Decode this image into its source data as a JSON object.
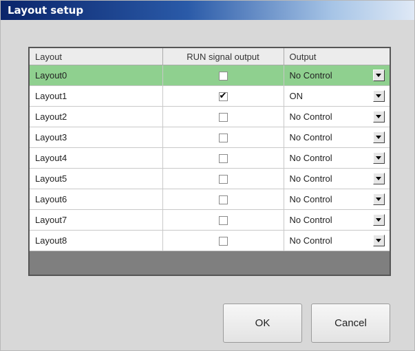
{
  "window": {
    "title": "Layout setup"
  },
  "table": {
    "columns": [
      "Layout",
      "RUN signal output",
      "Output"
    ],
    "rows": [
      {
        "layout": "Layout0",
        "run_signal": false,
        "output": "No Control",
        "selected": true
      },
      {
        "layout": "Layout1",
        "run_signal": true,
        "output": "ON",
        "selected": false
      },
      {
        "layout": "Layout2",
        "run_signal": false,
        "output": "No Control",
        "selected": false
      },
      {
        "layout": "Layout3",
        "run_signal": false,
        "output": "No Control",
        "selected": false
      },
      {
        "layout": "Layout4",
        "run_signal": false,
        "output": "No Control",
        "selected": false
      },
      {
        "layout": "Layout5",
        "run_signal": false,
        "output": "No Control",
        "selected": false
      },
      {
        "layout": "Layout6",
        "run_signal": false,
        "output": "No Control",
        "selected": false
      },
      {
        "layout": "Layout7",
        "run_signal": false,
        "output": "No Control",
        "selected": false
      },
      {
        "layout": "Layout8",
        "run_signal": false,
        "output": "No Control",
        "selected": false
      }
    ],
    "selected_row_color": "#8fd08f"
  },
  "buttons": {
    "ok": "OK",
    "cancel": "Cancel"
  },
  "icons": {
    "dropdown": "chevron-down-icon",
    "check": "checkmark-icon"
  }
}
